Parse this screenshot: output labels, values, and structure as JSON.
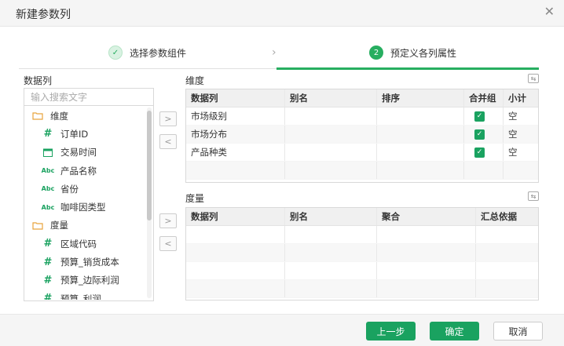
{
  "dialog": {
    "title": "新建参数列"
  },
  "steps": [
    {
      "number": "✓",
      "label": "选择参数组件"
    },
    {
      "number": "2",
      "label": "预定义各列属性"
    }
  ],
  "left": {
    "title": "数据列",
    "search_placeholder": "输入搜索文字",
    "groups": [
      {
        "label": "维度",
        "items": [
          {
            "icon": "hash-icon",
            "label": "订单ID"
          },
          {
            "icon": "calendar-icon",
            "label": "交易时间"
          },
          {
            "icon": "abc-icon",
            "label": "产品名称"
          },
          {
            "icon": "abc-icon",
            "label": "省份"
          },
          {
            "icon": "abc-icon",
            "label": "咖啡因类型"
          }
        ]
      },
      {
        "label": "度量",
        "items": [
          {
            "icon": "hash-icon",
            "label": "区域代码"
          },
          {
            "icon": "hash-icon",
            "label": "预算_销货成本"
          },
          {
            "icon": "hash-icon",
            "label": "预算_边际利润"
          },
          {
            "icon": "hash-icon",
            "label": "预算_利润"
          }
        ]
      }
    ]
  },
  "dimension": {
    "title": "维度",
    "headers": [
      "数据列",
      "别名",
      "排序",
      "合并组",
      "小计"
    ],
    "rows": [
      {
        "col": "市场级别",
        "alias": "",
        "sort": "",
        "merge": true,
        "subtotal": "空"
      },
      {
        "col": "市场分布",
        "alias": "",
        "sort": "",
        "merge": true,
        "subtotal": "空"
      },
      {
        "col": "产品种类",
        "alias": "",
        "sort": "",
        "merge": true,
        "subtotal": "空"
      }
    ]
  },
  "measure": {
    "title": "度量",
    "headers": [
      "数据列",
      "别名",
      "聚合",
      "汇总依据"
    ],
    "rows": []
  },
  "buttons": {
    "prev": "上一步",
    "ok": "确定",
    "cancel": "取消"
  },
  "colors": {
    "accent": "#1aa260",
    "active_step": "#27ae60"
  }
}
